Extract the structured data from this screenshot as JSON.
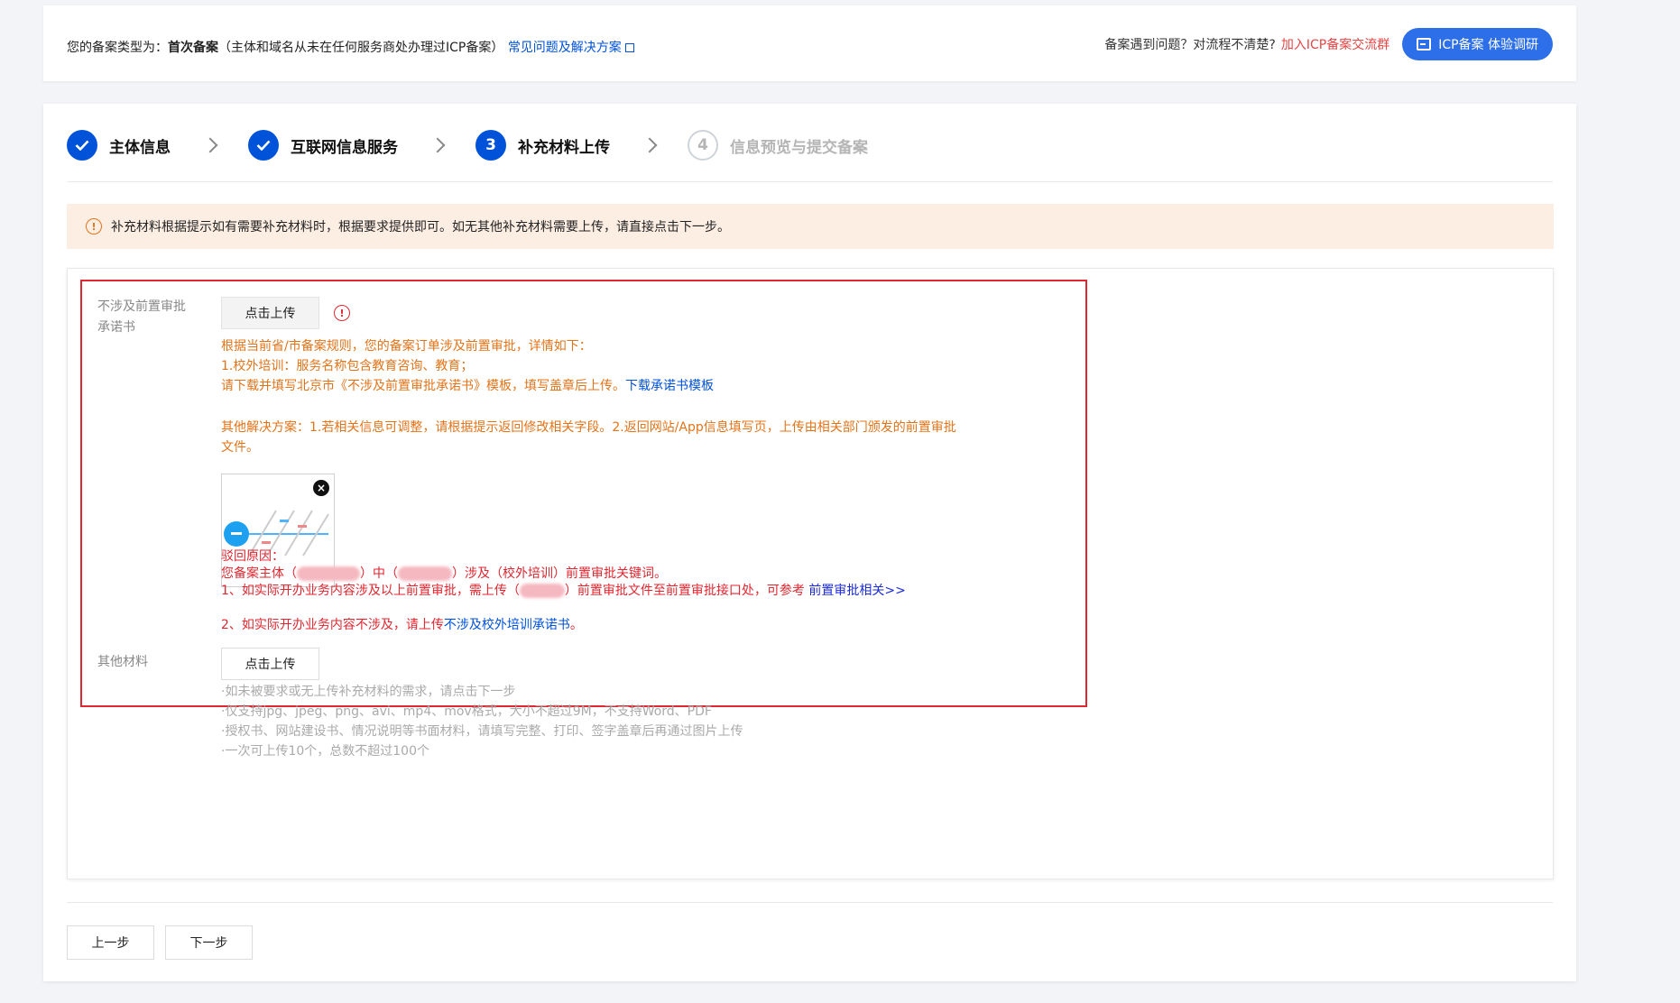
{
  "topbar": {
    "type_prefix": "您的备案类型为：",
    "type_value": "首次备案",
    "type_note": "（主体和域名从未在任何服务商处办理过ICP备案）",
    "faq_link": "常见问题及解决方案",
    "help_text": "备案遇到问题？对流程不清楚?",
    "join_link": "加入ICP备案交流群",
    "survey_button": "ICP备案  体验调研"
  },
  "steps": [
    {
      "label": "主体信息",
      "status": "done"
    },
    {
      "label": "互联网信息服务",
      "status": "done"
    },
    {
      "label": "补充材料上传",
      "status": "current",
      "number": "3"
    },
    {
      "label": "信息预览与提交备案",
      "status": "pending",
      "number": "4"
    }
  ],
  "alert": {
    "icon": "!",
    "text": "补充材料根据提示如有需要补充材料时，根据要求提供即可。如无其他补充材料需要上传，请直接点击下一步。"
  },
  "field1": {
    "label_line1": "不涉及前置审批",
    "label_line2": "承诺书",
    "upload_label": "点击上传",
    "warn_icon": "!",
    "orange_lines": [
      "根据当前省/市备案规则，您的备案订单涉及前置审批，详情如下：",
      "1.校外培训：服务名称包含教育咨询、教育；",
      "请下载并填写北京市《不涉及前置审批承诺书》模板，填写盖章后上传。"
    ],
    "download_link": "下载承诺书模板",
    "other_solution_1": "其他解决方案：1.若相关信息可调整，请根据提示返回修改相关字段。2.返回网站/App信息填写页，上传由相关部门颁发的前置审批",
    "other_solution_2": "文件。",
    "thumb_close": "×",
    "reject_title": "驳回原因：",
    "reject_line1_a": "您备案主体（",
    "reject_line1_b": "）中（",
    "reject_line1_c": "）涉及（校外培训）前置审批关键词。",
    "reject_line2_a": "1、如实际开办业务内容涉及以上前置审批，需上传（",
    "reject_line2_b": "）前置审批文件至前置审批接口处，可参考",
    "reject_line2_link": "前置审批相关>>",
    "reject_line3_a": "2、如实际开办业务内容不涉及，请上传",
    "reject_line3_link": "不涉及校外培训承诺书",
    "reject_line3_end": "。"
  },
  "field2": {
    "label": "其他材料",
    "upload_label": "点击上传",
    "hints": [
      "·如未被要求或无上传补充材料的需求，请点击下一步",
      "·仅支持jpg、jpeg、png、avi、mp4、mov格式，大小不超过9M，不支持Word、PDF",
      "·授权书、网站建设书、情况说明等书面材料，请填写完整、打印、签字盖章后再通过图片上传",
      "·一次可上传10个，总数不超过100个"
    ]
  },
  "footer": {
    "prev_button": "上一步",
    "next_button": "下一步"
  }
}
